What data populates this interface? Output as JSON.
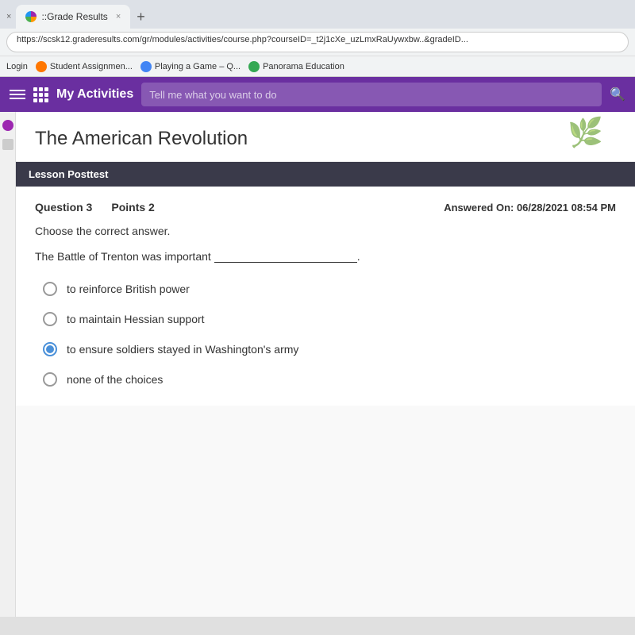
{
  "browser": {
    "tab_close": "×",
    "tab_title": "::Grade Results",
    "tab_new": "+",
    "address_url": "https://scsk12.graderesults.com/gr/modules/activities/course.php?courseID=_t2j1cXe_uzLmxRaUywxbw..&gradeID...",
    "bookmarks": [
      {
        "label": "Login",
        "color": "#888"
      },
      {
        "label": "Student Assignmen...",
        "color": "#ff7700"
      },
      {
        "label": "Playing a Game – Q...",
        "color": "#4285f4"
      },
      {
        "label": "Panorama Education",
        "color": "#34a853"
      }
    ]
  },
  "app_header": {
    "my_activities": "My Activities",
    "search_placeholder": "Tell me what you want to do",
    "search_icon": "🔍"
  },
  "page": {
    "title": "The American Revolution",
    "section_label": "Lesson Posttest",
    "question_number": "Question 3",
    "points": "Points 2",
    "answered_on": "Answered On: 06/28/2021 08:54 PM",
    "instruction": "Choose the correct answer.",
    "question_text": "The Battle of Trenton was important",
    "options": [
      {
        "text": "to reinforce British power",
        "selected": false
      },
      {
        "text": "to maintain Hessian support",
        "selected": false
      },
      {
        "text": "to ensure soldiers stayed in Washington's army",
        "selected": true
      },
      {
        "text": "none of the choices",
        "selected": false
      }
    ]
  }
}
